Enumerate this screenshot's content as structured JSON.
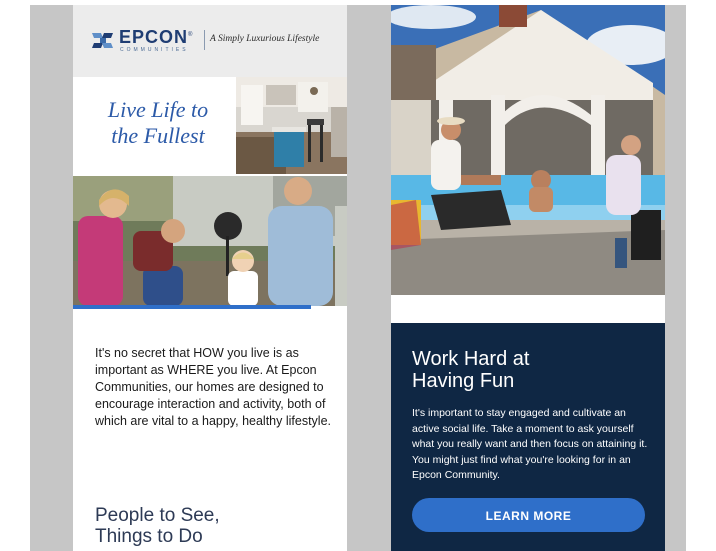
{
  "left_email": {
    "logo": {
      "wordmark": "EPCON",
      "registered": "®",
      "subtext": "COMMUNITIES"
    },
    "tagline": "A Simply Luxurious Lifestyle",
    "hero_heading": {
      "line1": "Live Life to",
      "line2": "the Fullest"
    },
    "body": "It's no secret that HOW you live is as important as WHERE you live. At Epcon Communities, our homes are designed to encourage interaction and activity, both of which are vital to a happy, healthy lifestyle.",
    "section_heading": {
      "line1": "People to See,",
      "line2": "Things to Do"
    }
  },
  "right_email": {
    "heading": {
      "line1": "Work Hard at",
      "line2": "Having Fun"
    },
    "body": "It's important to stay engaged and cultivate an active social life. Take a moment to ask yourself what you really want and then focus on attaining it. You might just find what you're looking for in an Epcon Community.",
    "cta_label": "LEARN MORE"
  },
  "colors": {
    "brand_blue": "#2c5aa8",
    "accent_blue": "#2f6fc9",
    "navy": "#0f2744",
    "gutter_gray": "#c6c6c6"
  }
}
